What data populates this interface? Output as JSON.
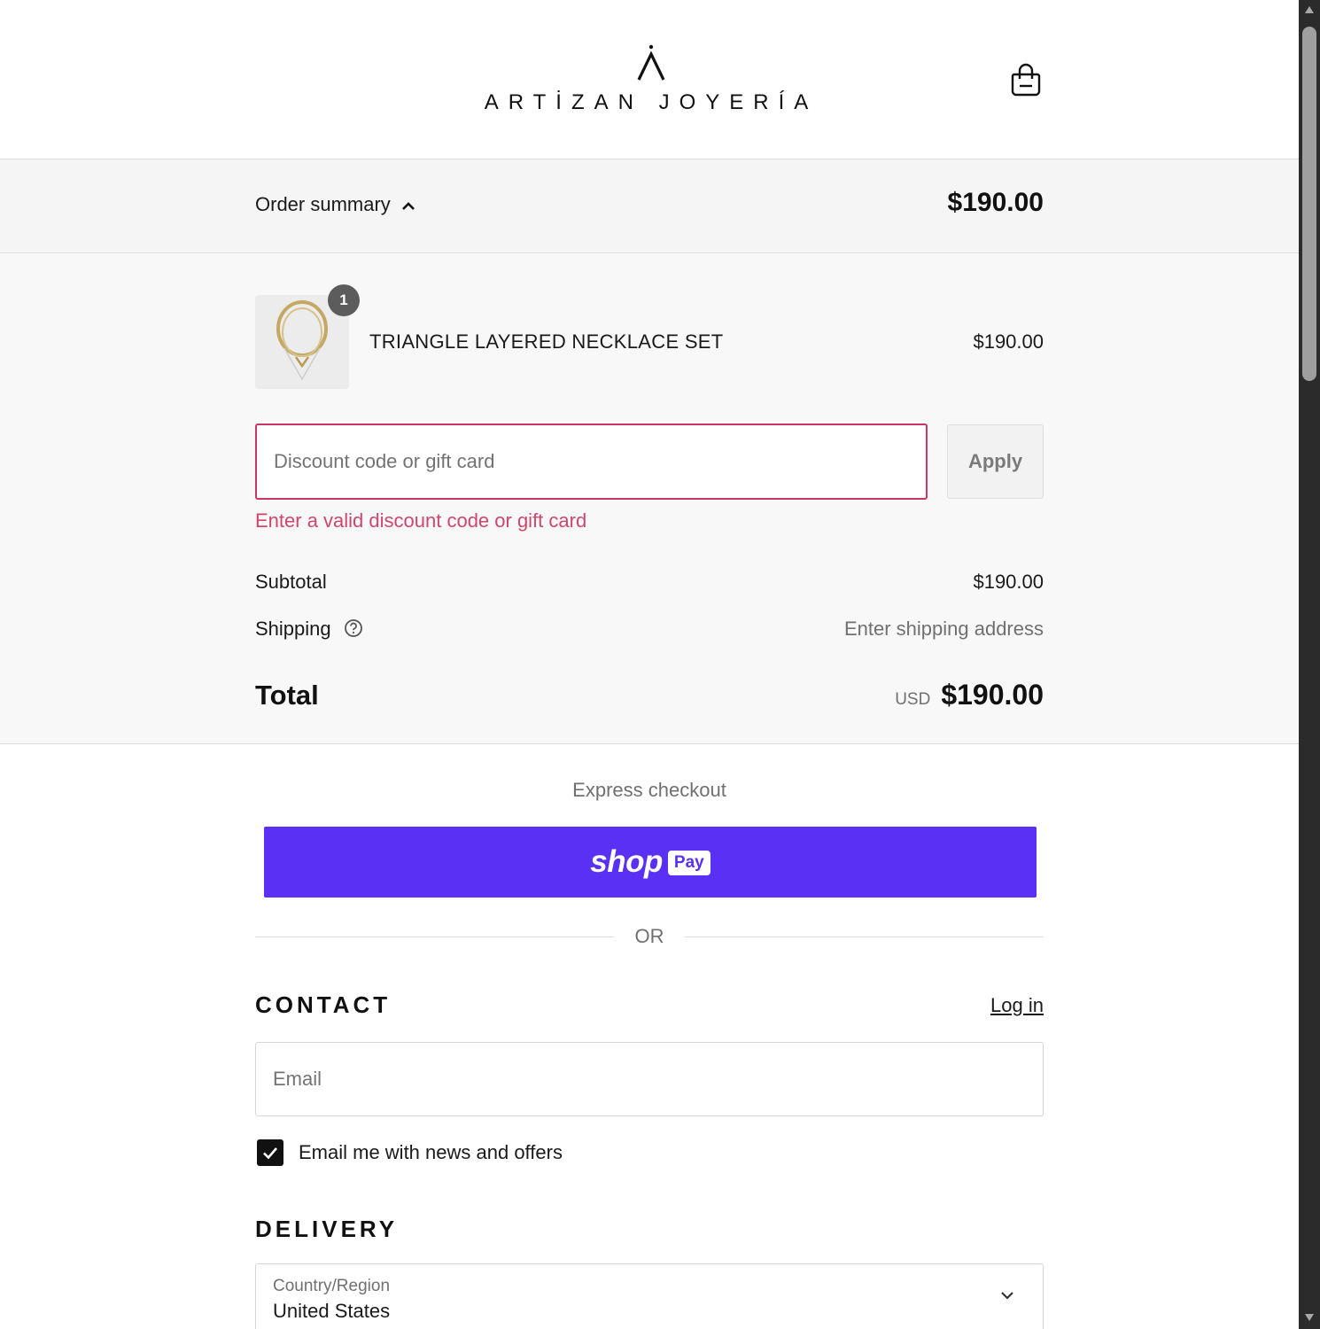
{
  "brand": {
    "name": "ARTİZAN JOYERÍA"
  },
  "header": {
    "cart_icon": "shopping-bag-icon"
  },
  "order_summary": {
    "toggle_label": "Order summary",
    "toggle_icon": "chevron-up-icon",
    "total": "$190.00"
  },
  "line_items": [
    {
      "name": "TRIANGLE LAYERED NECKLACE SET",
      "price": "$190.00",
      "quantity": "1"
    }
  ],
  "discount": {
    "placeholder": "Discount code or gift card",
    "value": "",
    "apply_label": "Apply",
    "error": "Enter a valid discount code or gift card"
  },
  "totals": {
    "subtotal_label": "Subtotal",
    "subtotal_value": "$190.00",
    "shipping_label": "Shipping",
    "shipping_value": "Enter shipping address",
    "total_label": "Total",
    "currency": "USD",
    "total_value": "$190.00"
  },
  "express": {
    "label": "Express checkout",
    "shop_word": "shop",
    "pay_word": "Pay",
    "or_label": "OR"
  },
  "contact": {
    "title": "CONTACT",
    "login_label": "Log in",
    "email_placeholder": "Email",
    "email_value": "",
    "newsletter_label": "Email me with news and offers",
    "newsletter_checked": true
  },
  "delivery": {
    "title": "DELIVERY",
    "country_caption": "Country/Region",
    "country_value": "United States"
  },
  "colors": {
    "shop_pay_purple": "#5a31f4",
    "error_pink": "#c73667",
    "summary_bg": "#f5f5f5"
  }
}
